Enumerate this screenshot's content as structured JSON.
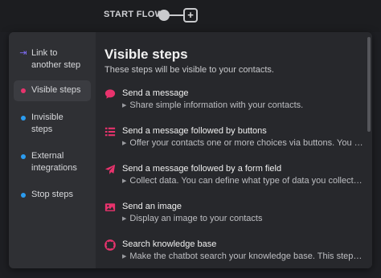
{
  "flow": {
    "label": "START FLOW",
    "add_symbol": "+"
  },
  "colors": {
    "accent_pink": "#e8336d",
    "accent_blue": "#2b9cf0",
    "link_purple": "#7f6cf4"
  },
  "sidebar": {
    "items": [
      {
        "label": "Link to another step",
        "marker": "link-arrow-icon",
        "active": false
      },
      {
        "label": "Visible steps",
        "marker": "pink-dot",
        "active": true
      },
      {
        "label": "Invisible steps",
        "marker": "blue-dot",
        "active": false
      },
      {
        "label": "External integrations",
        "marker": "blue-dot",
        "active": false
      },
      {
        "label": "Stop steps",
        "marker": "blue-dot",
        "active": false
      }
    ]
  },
  "main": {
    "title": "Visible steps",
    "subtitle": "These steps will be visible to your contacts.",
    "options": [
      {
        "title": "Send a message",
        "description": "Share simple information with your contacts.",
        "icon": "chat-bubble-icon"
      },
      {
        "title": "Send a message followed by buttons",
        "description": "Offer your contacts one or more choices via buttons. You can ...",
        "icon": "list-icon"
      },
      {
        "title": "Send a message followed by a form field",
        "description": "Collect data. You can define what type of data you collect (a t...",
        "icon": "send-plane-icon"
      },
      {
        "title": "Send an image",
        "description": "Display an image to your contacts",
        "icon": "image-icon"
      },
      {
        "title": "Search knowledge base",
        "description": "Make the chatbot search your knowledge base. This step will...",
        "icon": "lifebuoy-icon"
      }
    ]
  }
}
